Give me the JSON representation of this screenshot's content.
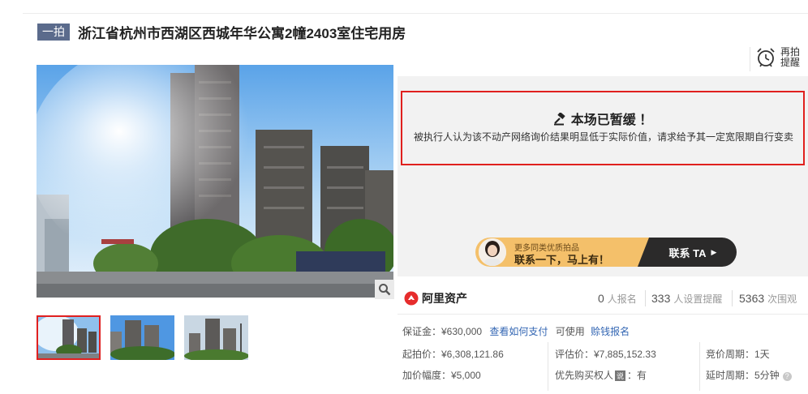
{
  "header": {
    "badge": "一拍",
    "title": "浙江省杭州市西湖区西城年华公寓2幢2403室住宅用房"
  },
  "remind": {
    "label": "再拍提醒",
    "icon": "alarm-clock-icon"
  },
  "notice": {
    "title": "本场已暂缓 ！",
    "body": "被执行人认为该不动产网络询价结果明显低于实际价值，请求给予其一定宽限期自行变卖",
    "icon": "gavel-icon"
  },
  "banner": {
    "small": "更多同类优质拍品",
    "big": "联系一下，马上有！",
    "cta": "联系 TA",
    "colors": {
      "left": "#f4c06a",
      "right": "#2b2a2a"
    }
  },
  "stats": {
    "brand": "阿里资产",
    "signup_count": "0",
    "signup_label": "人报名",
    "reminder_count": "333",
    "reminder_label": "人设置提醒",
    "view_count": "5363",
    "view_label": "次围观"
  },
  "deposit": {
    "label": "保证金：¥630,000",
    "pay_link": "查看如何支付",
    "usable": "可使用",
    "loan_link": "赊钱报名"
  },
  "details": {
    "start_price": "起拍价：¥6,308,121.86",
    "increment": "加价幅度：¥5,000",
    "appraisal": "评估价：¥7,885,152.33",
    "priority_prefix": "优先购买权人",
    "priority_tag": "说",
    "priority_value": "：有",
    "bid_cycle": "竞价周期：1天",
    "delay_cycle": "延时周期：5分钟"
  },
  "theme": {
    "accent": "#e0201e",
    "badge": "#5b6b8c",
    "link": "#3366b3"
  }
}
